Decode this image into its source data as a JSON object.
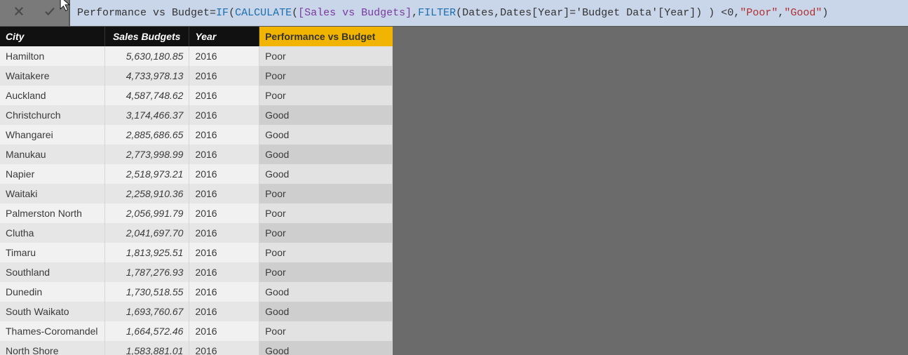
{
  "formula": {
    "measure_name": "Performance vs Budget",
    "eq": " = ",
    "if": "IF",
    "lp1": "( ",
    "calc": "CALCULATE",
    "lp2": "( ",
    "ref1": "[Sales vs Budgets]",
    "comma1": ", ",
    "filter": "FILTER",
    "lp3": "( ",
    "dates": "Dates",
    "comma2": ", ",
    "datesyear": "Dates[Year]",
    "eq2": " = ",
    "budgetyear": "'Budget Data'[Year]",
    "rp1": " ) ) < ",
    "zero": "0",
    "space1": " ,",
    "strPoor": "\"Poor\"",
    "comma3": ", ",
    "strGood": "\"Good\"",
    "rp2": ")"
  },
  "columns": {
    "city": "City",
    "budget": "Sales Budgets",
    "year": "Year",
    "perf": "Performance vs Budget"
  },
  "rows": [
    {
      "city": "Hamilton",
      "budget": "5,630,180.85",
      "year": "2016",
      "perf": "Poor"
    },
    {
      "city": "Waitakere",
      "budget": "4,733,978.13",
      "year": "2016",
      "perf": "Poor"
    },
    {
      "city": "Auckland",
      "budget": "4,587,748.62",
      "year": "2016",
      "perf": "Poor"
    },
    {
      "city": "Christchurch",
      "budget": "3,174,466.37",
      "year": "2016",
      "perf": "Good"
    },
    {
      "city": "Whangarei",
      "budget": "2,885,686.65",
      "year": "2016",
      "perf": "Good"
    },
    {
      "city": "Manukau",
      "budget": "2,773,998.99",
      "year": "2016",
      "perf": "Good"
    },
    {
      "city": "Napier",
      "budget": "2,518,973.21",
      "year": "2016",
      "perf": "Good"
    },
    {
      "city": "Waitaki",
      "budget": "2,258,910.36",
      "year": "2016",
      "perf": "Poor"
    },
    {
      "city": "Palmerston North",
      "budget": "2,056,991.79",
      "year": "2016",
      "perf": "Poor"
    },
    {
      "city": "Clutha",
      "budget": "2,041,697.70",
      "year": "2016",
      "perf": "Poor"
    },
    {
      "city": "Timaru",
      "budget": "1,813,925.51",
      "year": "2016",
      "perf": "Poor"
    },
    {
      "city": "Southland",
      "budget": "1,787,276.93",
      "year": "2016",
      "perf": "Poor"
    },
    {
      "city": "Dunedin",
      "budget": "1,730,518.55",
      "year": "2016",
      "perf": "Good"
    },
    {
      "city": "South Waikato",
      "budget": "1,693,760.67",
      "year": "2016",
      "perf": "Good"
    },
    {
      "city": "Thames-Coromandel",
      "budget": "1,664,572.46",
      "year": "2016",
      "perf": "Poor"
    },
    {
      "city": "North Shore",
      "budget": "1,583,881.01",
      "year": "2016",
      "perf": "Good"
    }
  ]
}
